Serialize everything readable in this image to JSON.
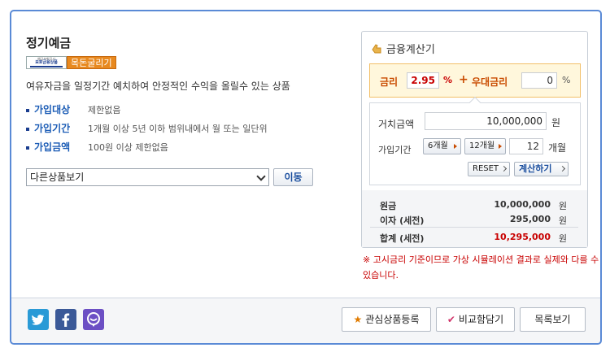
{
  "product": {
    "title": "정기예금",
    "badge_logo_line1": "예금보험공사",
    "badge_logo_line2": "보호금융상품",
    "badge_tag": "목돈굴리기",
    "description": "여유자금을 일정기간 예치하여 안정적인 수익을 올릴수 있는 상품",
    "info": [
      {
        "key": "가입대상",
        "value": "제한없음"
      },
      {
        "key": "가입기간",
        "value": "1개월 이상 5년 이하 범위내에서 월 또는 일단위"
      },
      {
        "key": "가입금액",
        "value": "100원 이상 제한없음"
      }
    ],
    "select_value": "다른상품보기",
    "move_label": "이동"
  },
  "calculator": {
    "title": "금융계산기",
    "rate_label": "금리",
    "rate_value": "2.95",
    "percent": "%",
    "plus": "+",
    "bonus_label": "우대금리",
    "bonus_value": "0",
    "amount_label": "거치금액",
    "amount_value": "10,000,000",
    "won": "원",
    "period_label": "가입기간",
    "period_6": "6개월",
    "period_12": "12개월",
    "period_value": "12",
    "months": "개월",
    "reset_label": "RESET",
    "calc_label": "계산하기",
    "results": [
      {
        "key": "원금",
        "value": "10,000,000",
        "unit": "원"
      },
      {
        "key": "이자 (세전)",
        "value": "295,000",
        "unit": "원"
      },
      {
        "key": "합계 (세전)",
        "value": "10,295,000",
        "unit": "원"
      }
    ],
    "notice": "※ 고시금리 기준이므로 가상 시뮬레이션 결과로 실제와 다를 수 있습니다."
  },
  "footer": {
    "favorite_label": "관심상품등록",
    "compare_label": "비교함담기",
    "list_label": "목록보기"
  },
  "colors": {
    "frame": "#5a8ad6",
    "accent_red": "#c80000",
    "label_blue": "#1a5bb5"
  }
}
